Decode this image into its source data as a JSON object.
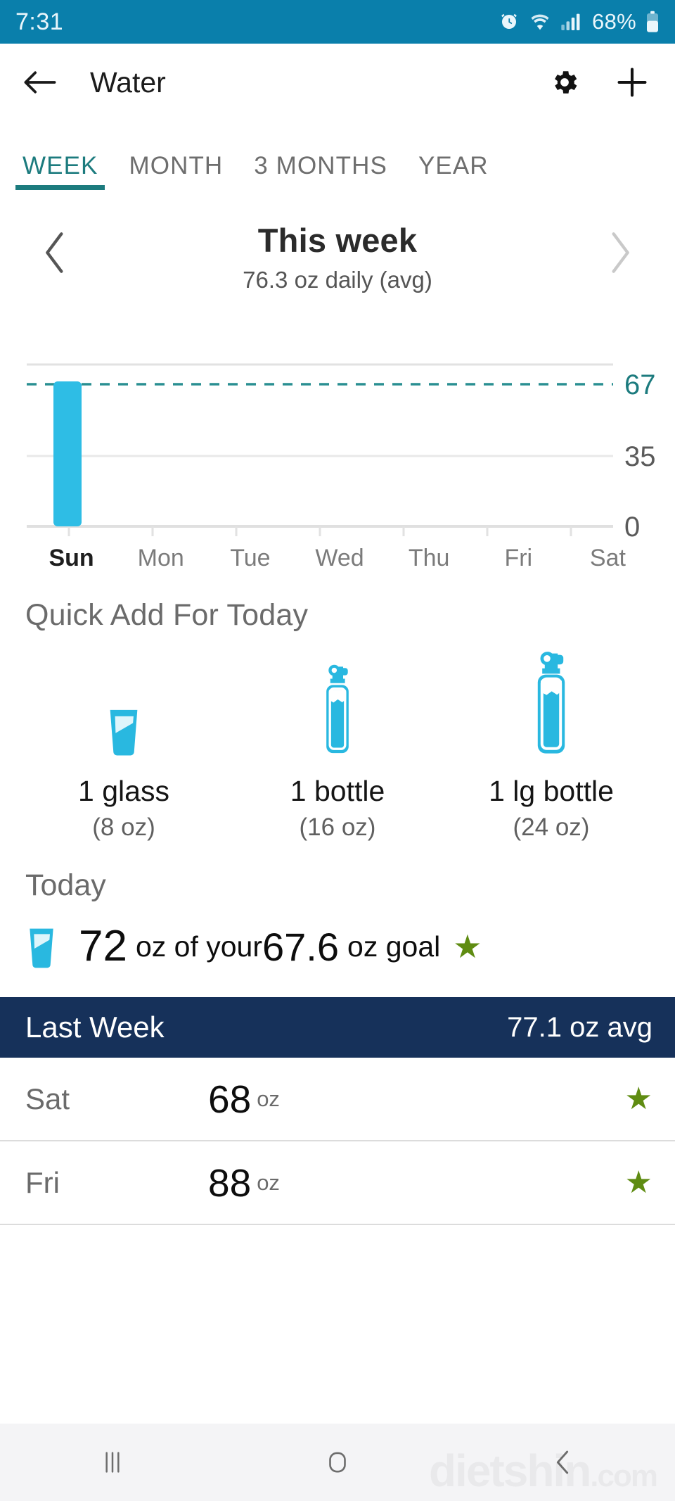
{
  "status_bar": {
    "time": "7:31",
    "battery_percent": "68%",
    "icons": [
      "alarm-icon",
      "wifi-icon",
      "signal-icon",
      "battery-icon"
    ],
    "background_color": "#0a7fab"
  },
  "app_bar": {
    "back_label": "←",
    "title": "Water",
    "settings_icon": "gear-icon",
    "add_icon": "plus-icon"
  },
  "tabs": {
    "items": [
      {
        "label": "WEEK",
        "active": true
      },
      {
        "label": "MONTH",
        "active": false
      },
      {
        "label": "3 MONTHS",
        "active": false
      },
      {
        "label": "YEAR",
        "active": false
      }
    ],
    "active_color": "#1c7b7e"
  },
  "period": {
    "title": "This week",
    "subtitle": "76.3 oz daily (avg)",
    "prev_label": "‹",
    "next_label": "›"
  },
  "chart_data": {
    "type": "bar",
    "title": "This week",
    "categories": [
      "Sun",
      "Mon",
      "Tue",
      "Wed",
      "Thu",
      "Fri",
      "Sat"
    ],
    "values": [
      72,
      0,
      0,
      0,
      0,
      0,
      0
    ],
    "highlight_category": "Sun",
    "ylabel": "",
    "xlabel": "",
    "ylim": [
      0,
      80
    ],
    "yticks": [
      "0",
      "35",
      "67"
    ],
    "ytick_values": [
      0,
      35,
      67
    ],
    "goal_line": 67,
    "goal_label": "67",
    "grid": true,
    "legend": "none",
    "bar_color": "#2ebde5",
    "goal_line_color": "#1c7b7e"
  },
  "quick_add": {
    "title": "Quick Add For Today",
    "items": [
      {
        "icon": "glass-icon",
        "label": "1 glass",
        "amount": "(8 oz)"
      },
      {
        "icon": "bottle-icon",
        "label": "1 bottle",
        "amount": "(16 oz)"
      },
      {
        "icon": "large-bottle-icon",
        "label": "1 lg bottle",
        "amount": "(24 oz)"
      }
    ]
  },
  "today": {
    "title": "Today",
    "icon": "glass-icon",
    "amount": "72",
    "middle_text": "oz of your",
    "goal": "67.6",
    "goal_suffix": "oz goal",
    "star_icon": "star-icon",
    "star_color": "#5f8c12"
  },
  "last_week": {
    "label": "Last Week",
    "average": "77.1 oz avg",
    "background_color": "#16315a",
    "rows": [
      {
        "day": "Sat",
        "value": "68",
        "unit": "oz",
        "star": "★"
      },
      {
        "day": "Fri",
        "value": "88",
        "unit": "oz",
        "star": "★"
      }
    ]
  },
  "nav_bar": {
    "recents_icon": "recents-icon",
    "home_icon": "home-icon",
    "back_icon": "back-icon"
  },
  "watermark": {
    "text": "dietshin",
    "suffix": ".com"
  }
}
